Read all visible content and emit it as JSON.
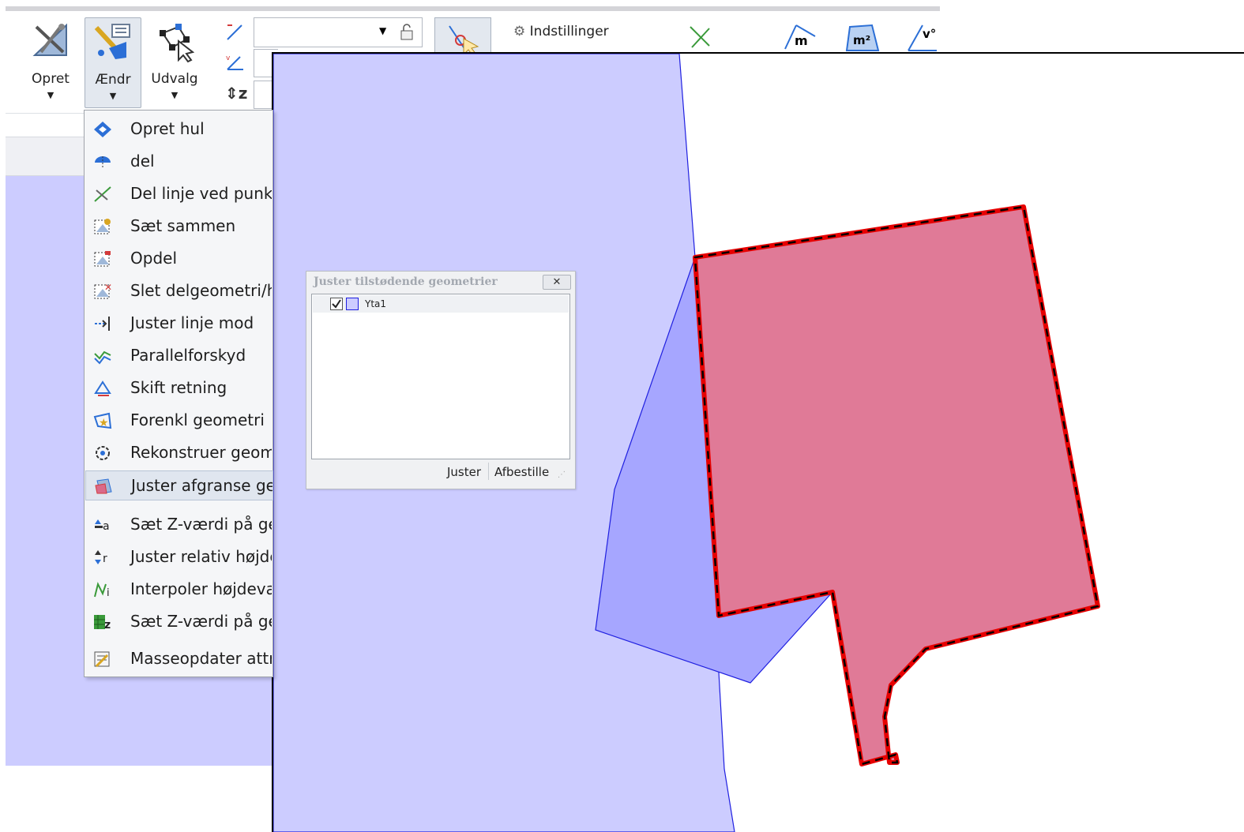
{
  "ribbon": {
    "buttons": [
      {
        "label": "Opret",
        "icon": "ruler-compass-icon"
      },
      {
        "label": "Ændr",
        "icon": "edit-geometry-icon"
      },
      {
        "label": "Udvalg",
        "icon": "selection-icon"
      }
    ],
    "settings_label": "Indstillinger",
    "measure_tools": [
      "m",
      "m²",
      "v°"
    ],
    "z_label": "z"
  },
  "menu": {
    "items": [
      {
        "label": "Opret hul",
        "icon": "create-hole-icon"
      },
      {
        "label": "del",
        "icon": "split-icon"
      },
      {
        "label": "Del linje ved punkt",
        "icon": "split-line-icon"
      },
      {
        "label": "Sæt sammen",
        "icon": "merge-icon"
      },
      {
        "label": "Opdel",
        "icon": "explode-icon"
      },
      {
        "label": "Slet delgeometri/hu",
        "icon": "delete-part-icon"
      },
      {
        "label": "Juster linje mod",
        "icon": "extend-line-icon"
      },
      {
        "label": "Parallelforskyd",
        "icon": "parallel-offset-icon"
      },
      {
        "label": "Skift retning",
        "icon": "reverse-direction-icon"
      },
      {
        "label": "Forenkl geometri",
        "icon": "simplify-icon"
      },
      {
        "label": "Rekonstruer geome",
        "icon": "reconstruct-icon"
      },
      {
        "label": "Juster afgranse geo",
        "icon": "adjust-bounding-icon"
      },
      {
        "label": "Sæt Z-værdi på geo",
        "icon": "set-z-icon"
      },
      {
        "label": "Juster relativ højdev",
        "icon": "relative-height-icon"
      },
      {
        "label": "Interpoler højdevær",
        "icon": "interpolate-height-icon"
      },
      {
        "label": "Sæt Z-værdi på geo",
        "icon": "set-z-grid-icon"
      },
      {
        "label": "Masseopdater attrib",
        "icon": "mass-update-icon"
      }
    ],
    "highlighted_index": 11
  },
  "dialog": {
    "title": "Juster tilstødende geometrier",
    "close_label": "✕",
    "items": [
      {
        "label": "Yta1",
        "checked": true
      }
    ],
    "buttons": {
      "adjust": "Juster",
      "cancel": "Afbestille"
    }
  },
  "colors": {
    "polygon_light": "#ccccff",
    "polygon_overlap": "#a6a6ff",
    "selected_fill": "#e07a97",
    "selected_outline": "#e60000",
    "highlight": "#e0e6ef"
  }
}
